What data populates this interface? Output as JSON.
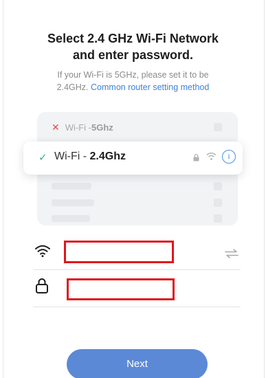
{
  "header": {
    "title_line1": "Select 2.4 GHz Wi-Fi Network",
    "title_line2": "and enter password.",
    "subtitle_line1": "If your Wi-Fi is 5GHz, please set it to be",
    "subtitle_prefix": "2.4GHz.",
    "subtitle_link": "Common router setting method"
  },
  "networks": [
    {
      "prefix": "Wi-Fi - ",
      "band": "5Ghz",
      "status": "unsupported",
      "icon": "x-mark-icon"
    },
    {
      "prefix": "Wi-Fi - ",
      "band": "2.4Ghz",
      "status": "selected",
      "icon": "checkmark-icon"
    }
  ],
  "form": {
    "wifi_field": {
      "icon": "wifi-icon",
      "value": ""
    },
    "password_field": {
      "icon": "lock-icon",
      "value": ""
    }
  },
  "footer": {
    "next_label": "Next"
  },
  "colors": {
    "accent": "#5b89d6",
    "link": "#3d82d8",
    "check": "#3aaf75",
    "error": "#e64c4c",
    "redaction": "#e0151b"
  }
}
